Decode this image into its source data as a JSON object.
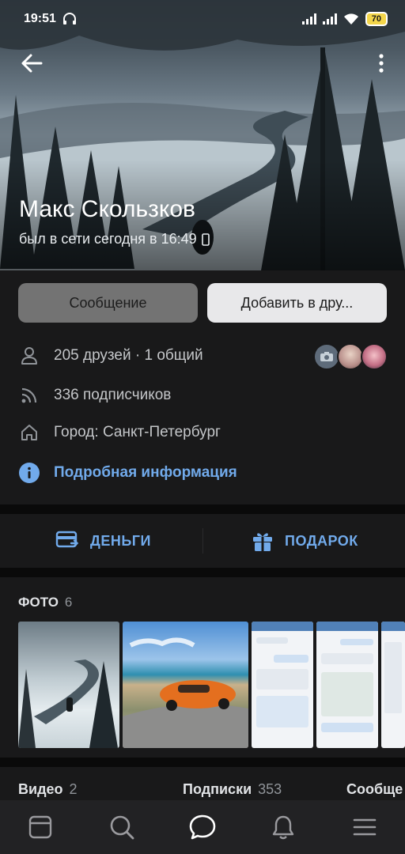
{
  "status_bar": {
    "time": "19:51",
    "battery": "70"
  },
  "profile": {
    "name": "Макс Скользков",
    "online_status": "был в сети сегодня в 16:49"
  },
  "buttons": {
    "message": "Сообщение",
    "add_friend": "Добавить в дру..."
  },
  "info": {
    "friends": "205 друзей · 1 общий",
    "followers": "336 подписчиков",
    "city": "Город: Санкт-Петербург",
    "more": "Подробная информация"
  },
  "actions": {
    "money": "ДЕНЬГИ",
    "gift": "ПОДАРОК"
  },
  "photos": {
    "title": "ФОТО",
    "count": "6"
  },
  "counters": [
    {
      "label": "Видео",
      "count": "2"
    },
    {
      "label": "Подписки",
      "count": "353"
    },
    {
      "label": "Сообще"
    }
  ],
  "colors": {
    "accent": "#71aaeb",
    "card": "#19191a",
    "background": "#0a0a0a",
    "tab_bar": "#222224"
  },
  "tabs": [
    {
      "icon": "newsfeed-icon"
    },
    {
      "icon": "search-icon"
    },
    {
      "icon": "messages-icon",
      "active": true
    },
    {
      "icon": "notifications-icon"
    },
    {
      "icon": "menu-icon"
    }
  ]
}
